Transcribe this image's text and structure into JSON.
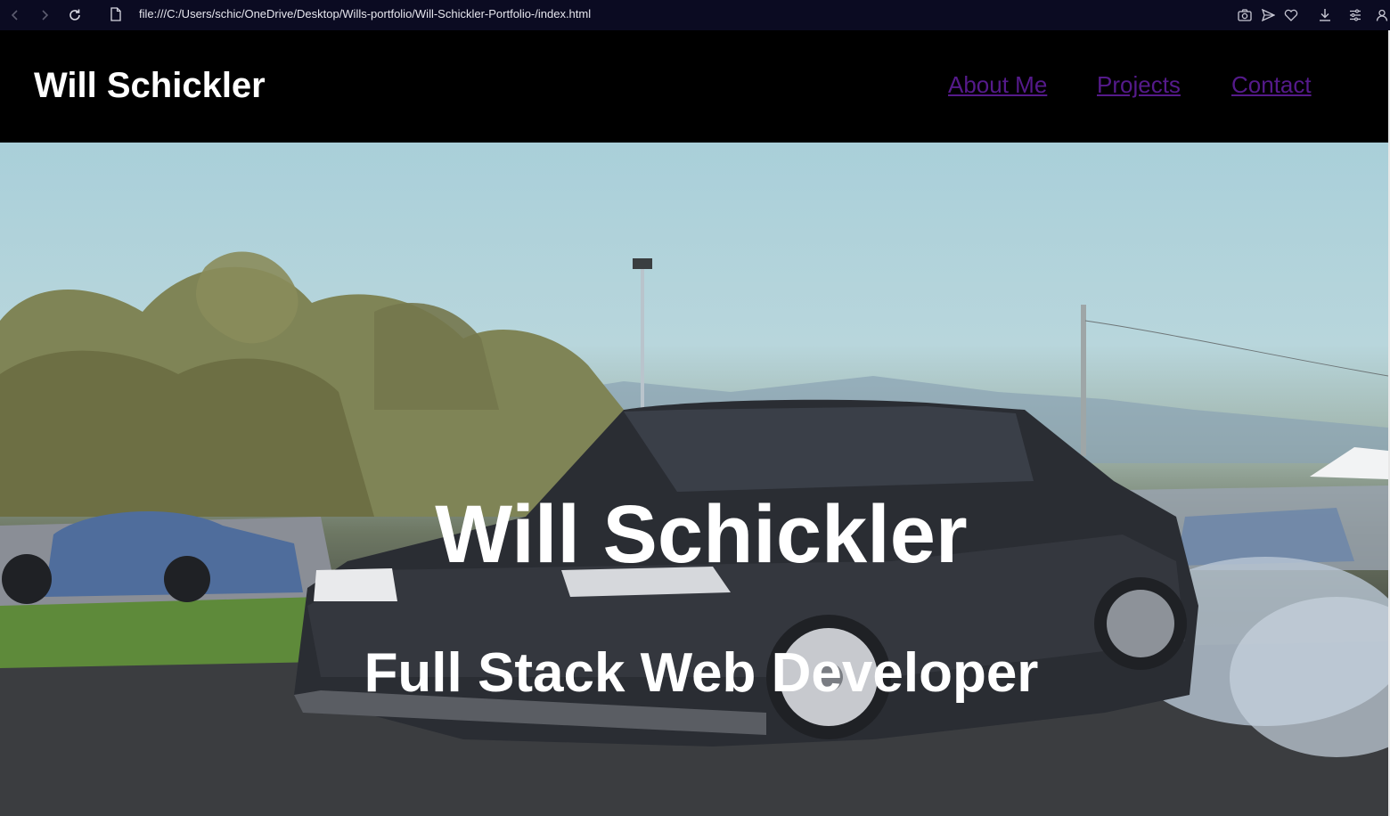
{
  "browser": {
    "url": "file:///C:/Users/schic/OneDrive/Desktop/Wills-portfolio/Will-Schickler-Portfolio-/index.html",
    "icons": [
      "back-icon",
      "forward-icon",
      "reload-icon",
      "page-icon",
      "camera-icon",
      "send-icon",
      "heart-icon",
      "download-icon",
      "menu-icon",
      "profile-icon"
    ]
  },
  "header": {
    "logo": "Will Schickler",
    "nav": [
      "About Me",
      "Projects",
      "Contact"
    ]
  },
  "hero": {
    "title": "Will Schickler",
    "subtitle": "Full Stack Web Developer"
  },
  "colors": {
    "header_bg": "#000000",
    "link": "#551a8b",
    "browser_bar": "#0b0b22",
    "text": "#ffffff"
  }
}
